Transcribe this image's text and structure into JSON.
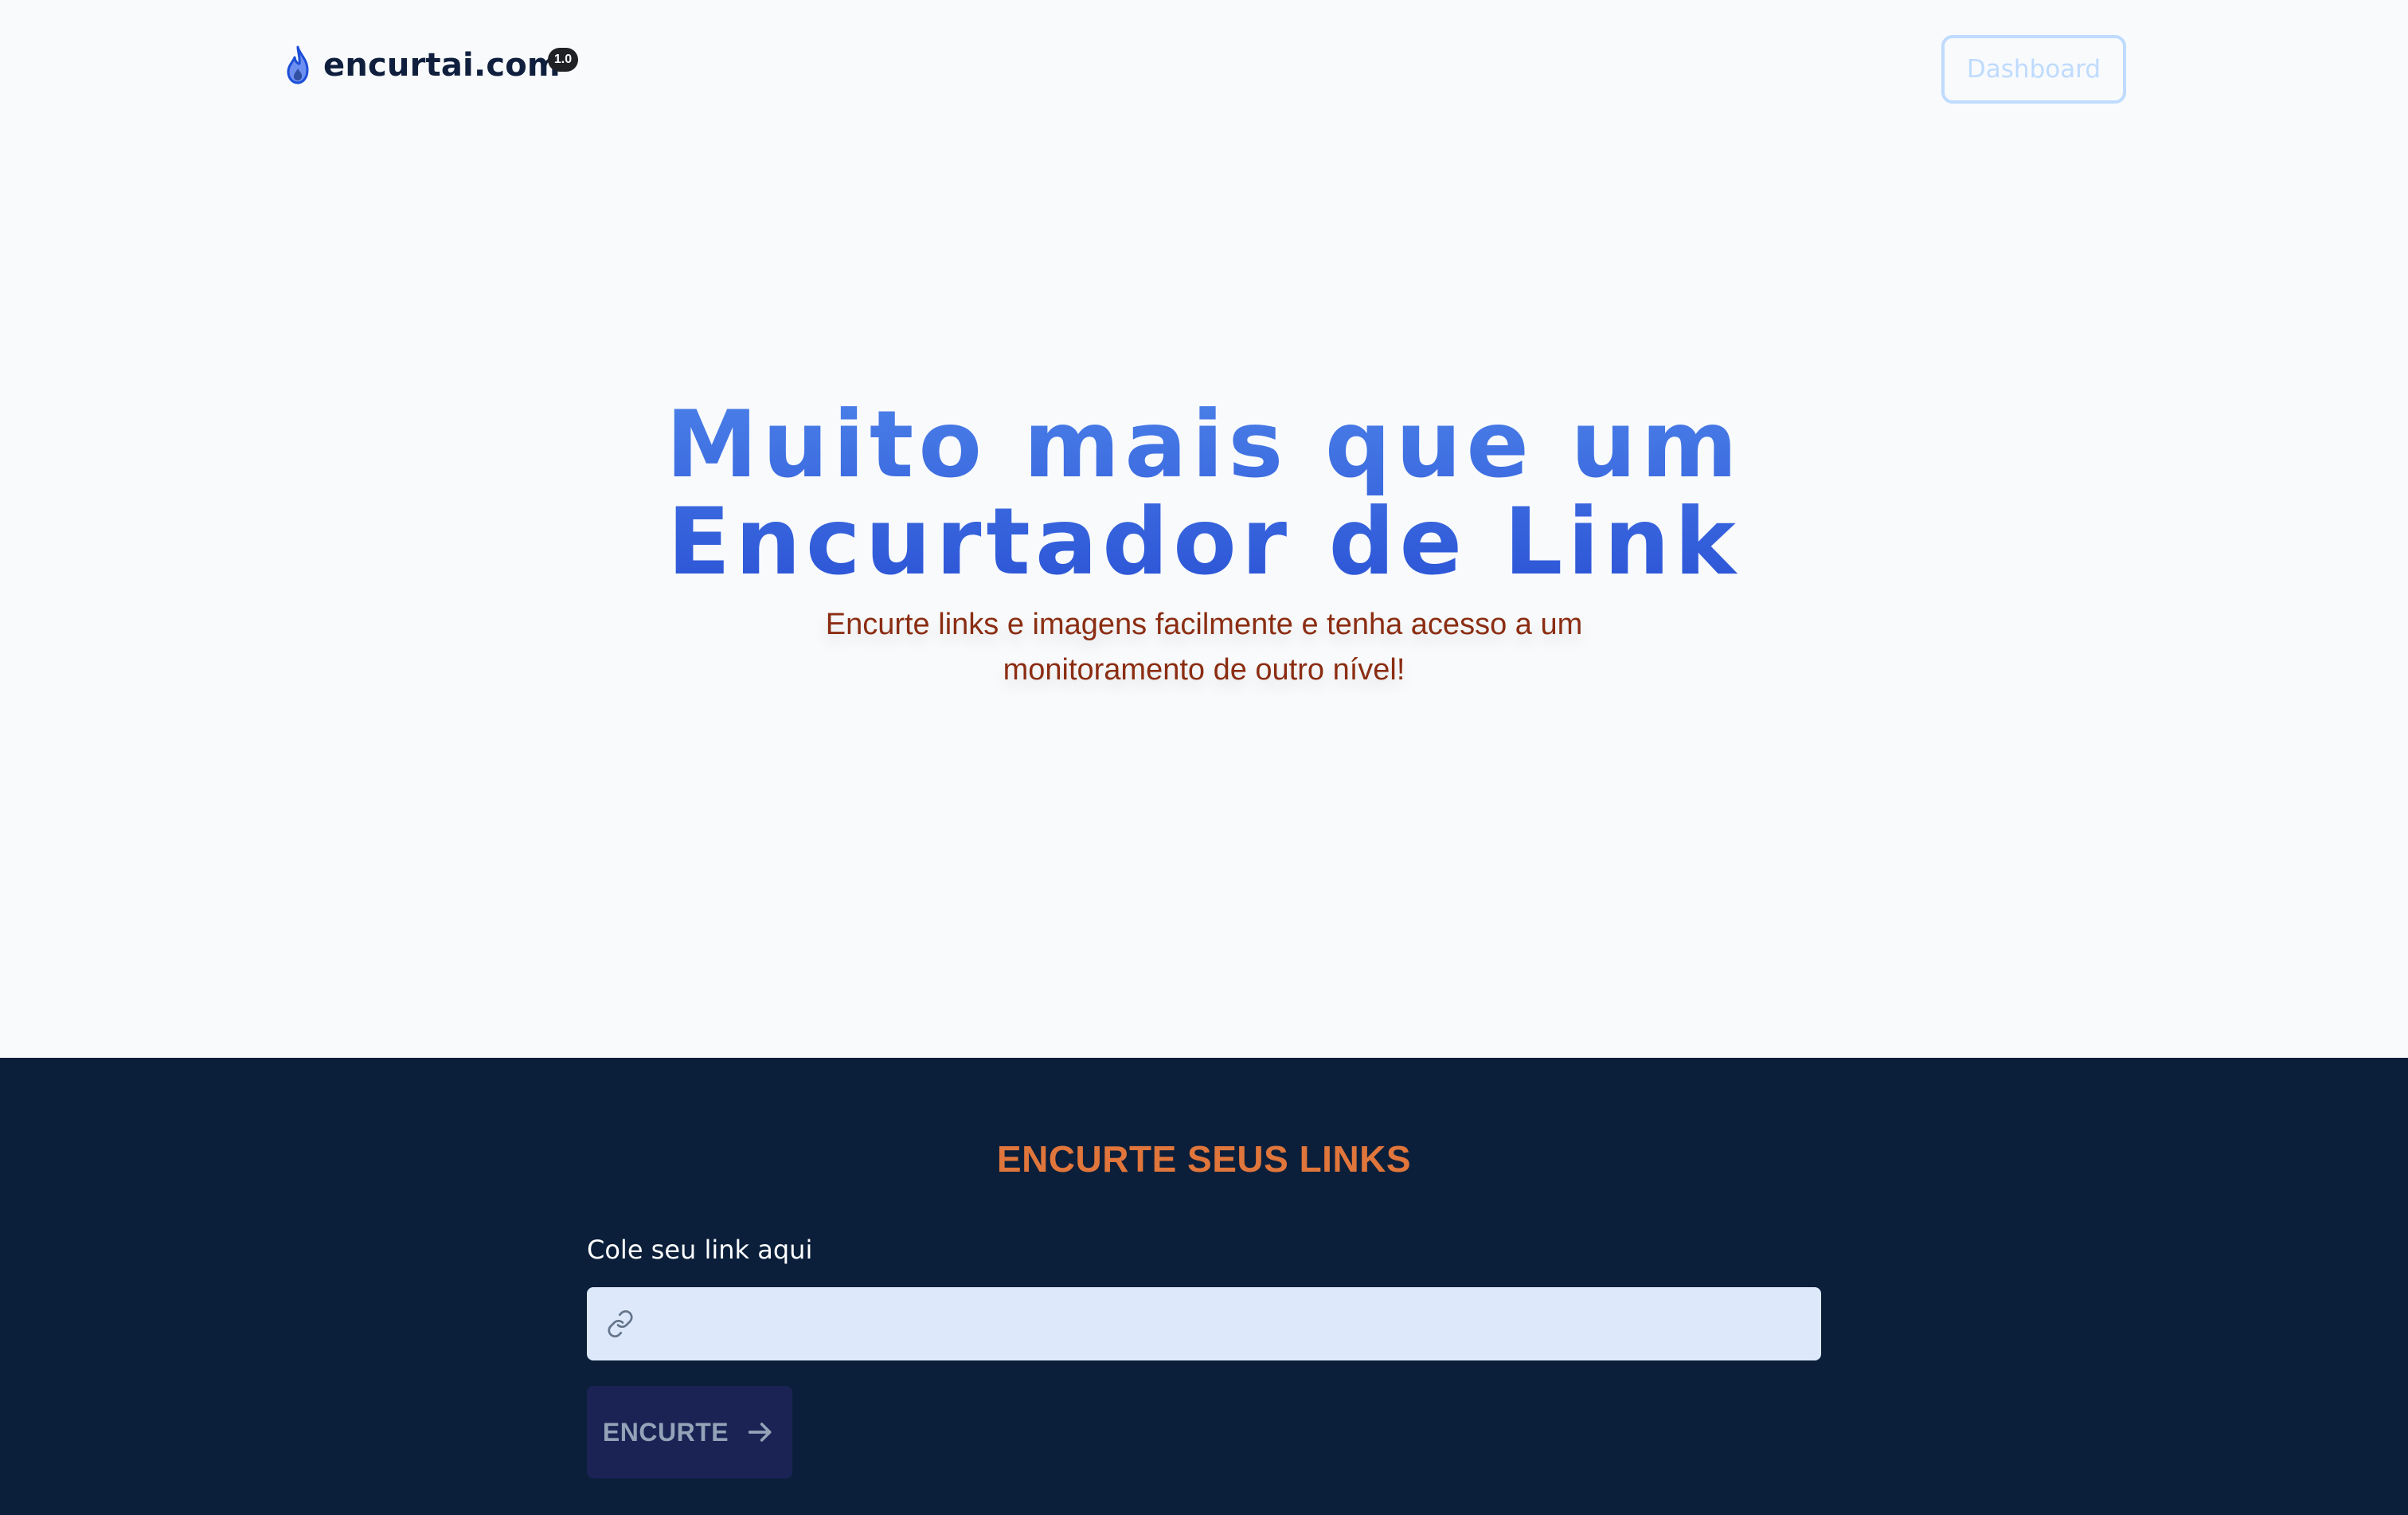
{
  "header": {
    "brand_name": "encurtai.com",
    "version": "1.0",
    "dashboard_label": "Dashboard"
  },
  "hero": {
    "title_line1": "Muito mais que um",
    "title_line2": "Encurtador de Link",
    "subtitle": "Encurte links e imagens facilmente e tenha acesso a um monitoramento de outro nível!"
  },
  "shorten": {
    "section_title": "ENCURTE SEUS LINKS",
    "input_label": "Cole seu link aqui",
    "input_value": "",
    "input_placeholder": "",
    "button_label": "ENCURTE"
  },
  "colors": {
    "page_background": "#f8fafc",
    "section_background": "#0b1f3a",
    "title_gradient_start": "#4a7fe8",
    "title_gradient_end": "#2c54d6",
    "subtitle_color": "#8b2d12",
    "section_title_color": "#e0763b",
    "input_background": "#dde9fb",
    "button_background": "#1b2355"
  },
  "icons": {
    "brand": "flame-icon",
    "input": "link-icon",
    "button": "arrow-right-icon"
  }
}
